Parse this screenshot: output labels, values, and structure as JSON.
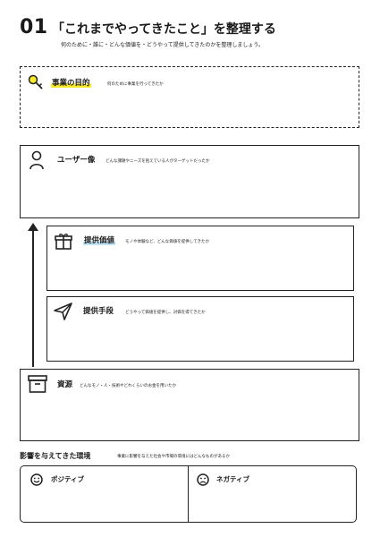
{
  "header": {
    "number": "01",
    "title": "「これまでやってきたこと」を整理する",
    "subtitle": "何のために・誰に・どんな価値を・どうやって提供してきたのかを整理しましょう。"
  },
  "purpose": {
    "title": "事業の目的",
    "desc": "何のために事業を行ってきたか",
    "icon": "key-icon",
    "highlight_color": "#f7ea2a"
  },
  "user": {
    "title": "ユーザー像",
    "desc": "どんな課題やニーズを抱えている人がターゲットだったか",
    "icon": "person-icon"
  },
  "value": {
    "title": "提供価値",
    "desc": "モノや体験など、どんな価値を提供してきたか",
    "icon": "gift-icon",
    "highlight_color": "#bfe4f4"
  },
  "method": {
    "title": "提供手段",
    "desc": "どうやって価値を提供し、対価を得てきたか",
    "icon": "paper-plane-icon"
  },
  "resources": {
    "title": "資源",
    "desc": "どんなモノ・人・技術やどれくらいのお金を用いたか",
    "icon": "archive-box-icon"
  },
  "environment": {
    "title": "影響を与えてきた環境",
    "desc": "事業に影響を与えた社会や市場の環境にはどんなものがあるか",
    "positive": {
      "label": "ポジティブ",
      "icon": "smile-icon"
    },
    "negative": {
      "label": "ネガティブ",
      "icon": "sad-icon"
    }
  }
}
